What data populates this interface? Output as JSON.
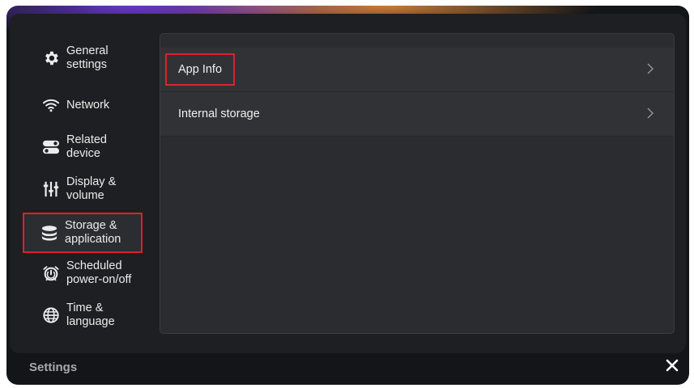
{
  "sidebar": {
    "items": [
      {
        "label": "General\nsettings",
        "icon": "gear-icon"
      },
      {
        "label": "Network",
        "icon": "wifi-icon"
      },
      {
        "label": "Related\ndevice",
        "icon": "toggle-device-icon"
      },
      {
        "label": "Display &\nvolume",
        "icon": "sliders-icon"
      },
      {
        "label": "Storage &\napplication",
        "icon": "storage-icon",
        "selected": true
      },
      {
        "label": "Scheduled\npower-on/off",
        "icon": "alarm-clock-icon"
      },
      {
        "label": "Time &\nlanguage",
        "icon": "globe-icon"
      }
    ]
  },
  "content": {
    "rows": [
      {
        "label": "App Info",
        "icon": "chevron-right-icon"
      },
      {
        "label": "Internal storage",
        "icon": "chevron-right-icon"
      }
    ]
  },
  "footer": {
    "title": "Settings",
    "close_icon": "close-icon"
  },
  "colors": {
    "background": "#141518",
    "panel": "#1e1f22",
    "row": "#303236",
    "highlight": "#e0202a"
  }
}
